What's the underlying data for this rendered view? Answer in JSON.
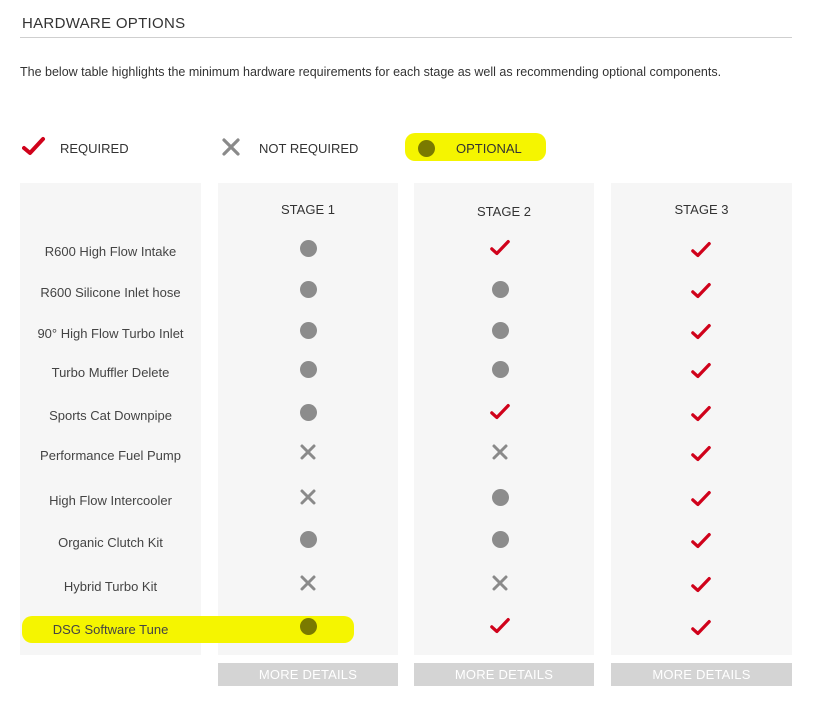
{
  "title": "HARDWARE OPTIONS",
  "intro": "The below table highlights the minimum hardware requirements for each stage as well as recommending optional components.",
  "colors": {
    "required": "#d0021b",
    "not_required": "#8a8a8a",
    "optional": "#8c8c8c",
    "highlight": "#f5f500"
  },
  "legend": [
    {
      "icon": "check-icon",
      "label": "REQUIRED"
    },
    {
      "icon": "x-icon",
      "label": "NOT REQUIRED"
    },
    {
      "icon": "dot-icon",
      "label": "OPTIONAL"
    }
  ],
  "stages": [
    "STAGE 1",
    "STAGE 2",
    "STAGE 3"
  ],
  "rows": [
    {
      "label": "R600 High Flow Intake",
      "values": [
        "optional",
        "required",
        "required"
      ]
    },
    {
      "label": "R600 Silicone Inlet hose",
      "values": [
        "optional",
        "optional",
        "required"
      ]
    },
    {
      "label": "90° High Flow Turbo Inlet",
      "values": [
        "optional",
        "optional",
        "required"
      ]
    },
    {
      "label": "Turbo Muffler Delete",
      "values": [
        "optional",
        "optional",
        "required"
      ]
    },
    {
      "label": "Sports Cat Downpipe",
      "values": [
        "optional",
        "required",
        "required"
      ]
    },
    {
      "label": "Performance Fuel Pump",
      "values": [
        "not_required",
        "not_required",
        "required"
      ]
    },
    {
      "label": "High Flow Intercooler",
      "values": [
        "not_required",
        "optional",
        "required"
      ]
    },
    {
      "label": "Organic Clutch Kit",
      "values": [
        "optional",
        "optional",
        "required"
      ]
    },
    {
      "label": "Hybrid Turbo Kit",
      "values": [
        "not_required",
        "not_required",
        "required"
      ]
    },
    {
      "label": "DSG Software Tune",
      "values": [
        "optional",
        "required",
        "required"
      ]
    }
  ],
  "more_details_label": "MORE DETAILS"
}
